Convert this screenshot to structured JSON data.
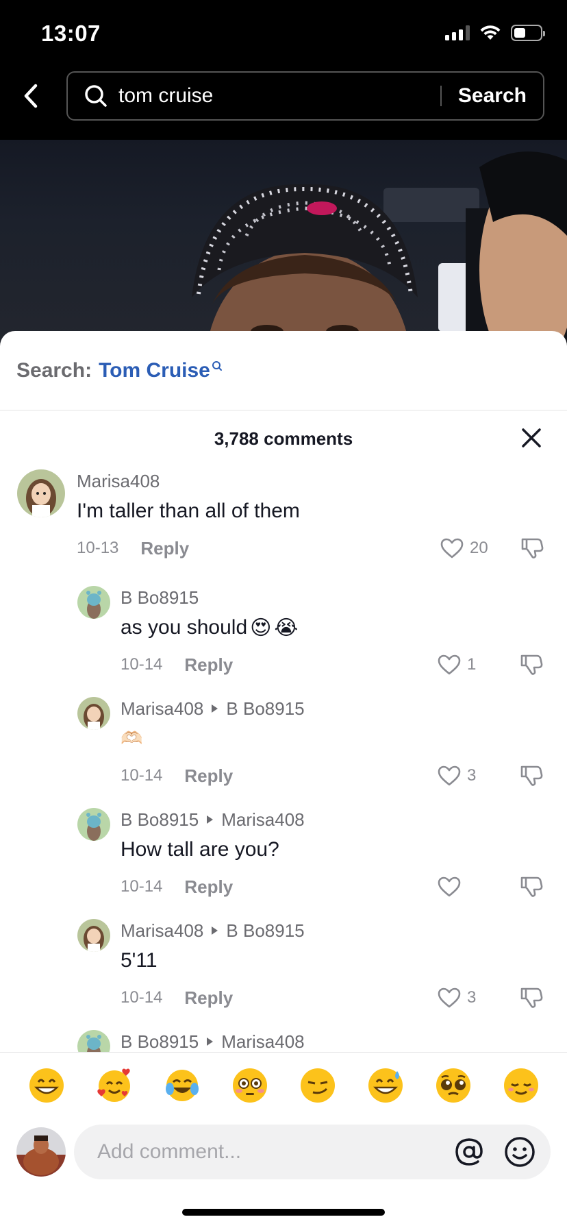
{
  "status_bar": {
    "time": "13:07"
  },
  "search": {
    "query": "tom cruise",
    "button_label": "Search"
  },
  "suggestion": {
    "prefix": "Search:",
    "term": "Tom Cruise"
  },
  "comments_header": {
    "count_label": "3,788 comments"
  },
  "comments": [
    {
      "user": "Marisa408",
      "reply_to": "",
      "text": "I'm taller than all of them",
      "emoji": [],
      "date": "10-13",
      "reply_label": "Reply",
      "likes": "20"
    },
    {
      "user": "B Bo8915",
      "reply_to": "",
      "text": "as you should",
      "emoji": [
        "😍",
        "😭"
      ],
      "date": "10-14",
      "reply_label": "Reply",
      "likes": "1"
    },
    {
      "user": "Marisa408",
      "reply_to": "B Bo8915",
      "text": "",
      "emoji": [
        "🫶🏻"
      ],
      "date": "10-14",
      "reply_label": "Reply",
      "likes": "3"
    },
    {
      "user": "B Bo8915",
      "reply_to": "Marisa408",
      "text": "How tall are you?",
      "emoji": [],
      "date": "10-14",
      "reply_label": "Reply",
      "likes": ""
    },
    {
      "user": "Marisa408",
      "reply_to": "B Bo8915",
      "text": "5'11",
      "emoji": [],
      "date": "10-14",
      "reply_label": "Reply",
      "likes": "3"
    },
    {
      "user": "B Bo8915",
      "reply_to": "Marisa408",
      "text": "",
      "emoji": [],
      "date": "",
      "reply_label": "",
      "likes": ""
    }
  ],
  "emoji_bar": [
    "😁",
    "🥰",
    "😂",
    "😳",
    "😏",
    "😅",
    "🥺",
    "😌"
  ],
  "comment_input": {
    "placeholder": "Add comment..."
  },
  "colors": {
    "link_blue": "#2b5db5",
    "muted": "#8a8b91",
    "text": "#161823",
    "input_bg": "#f1f1f2"
  }
}
